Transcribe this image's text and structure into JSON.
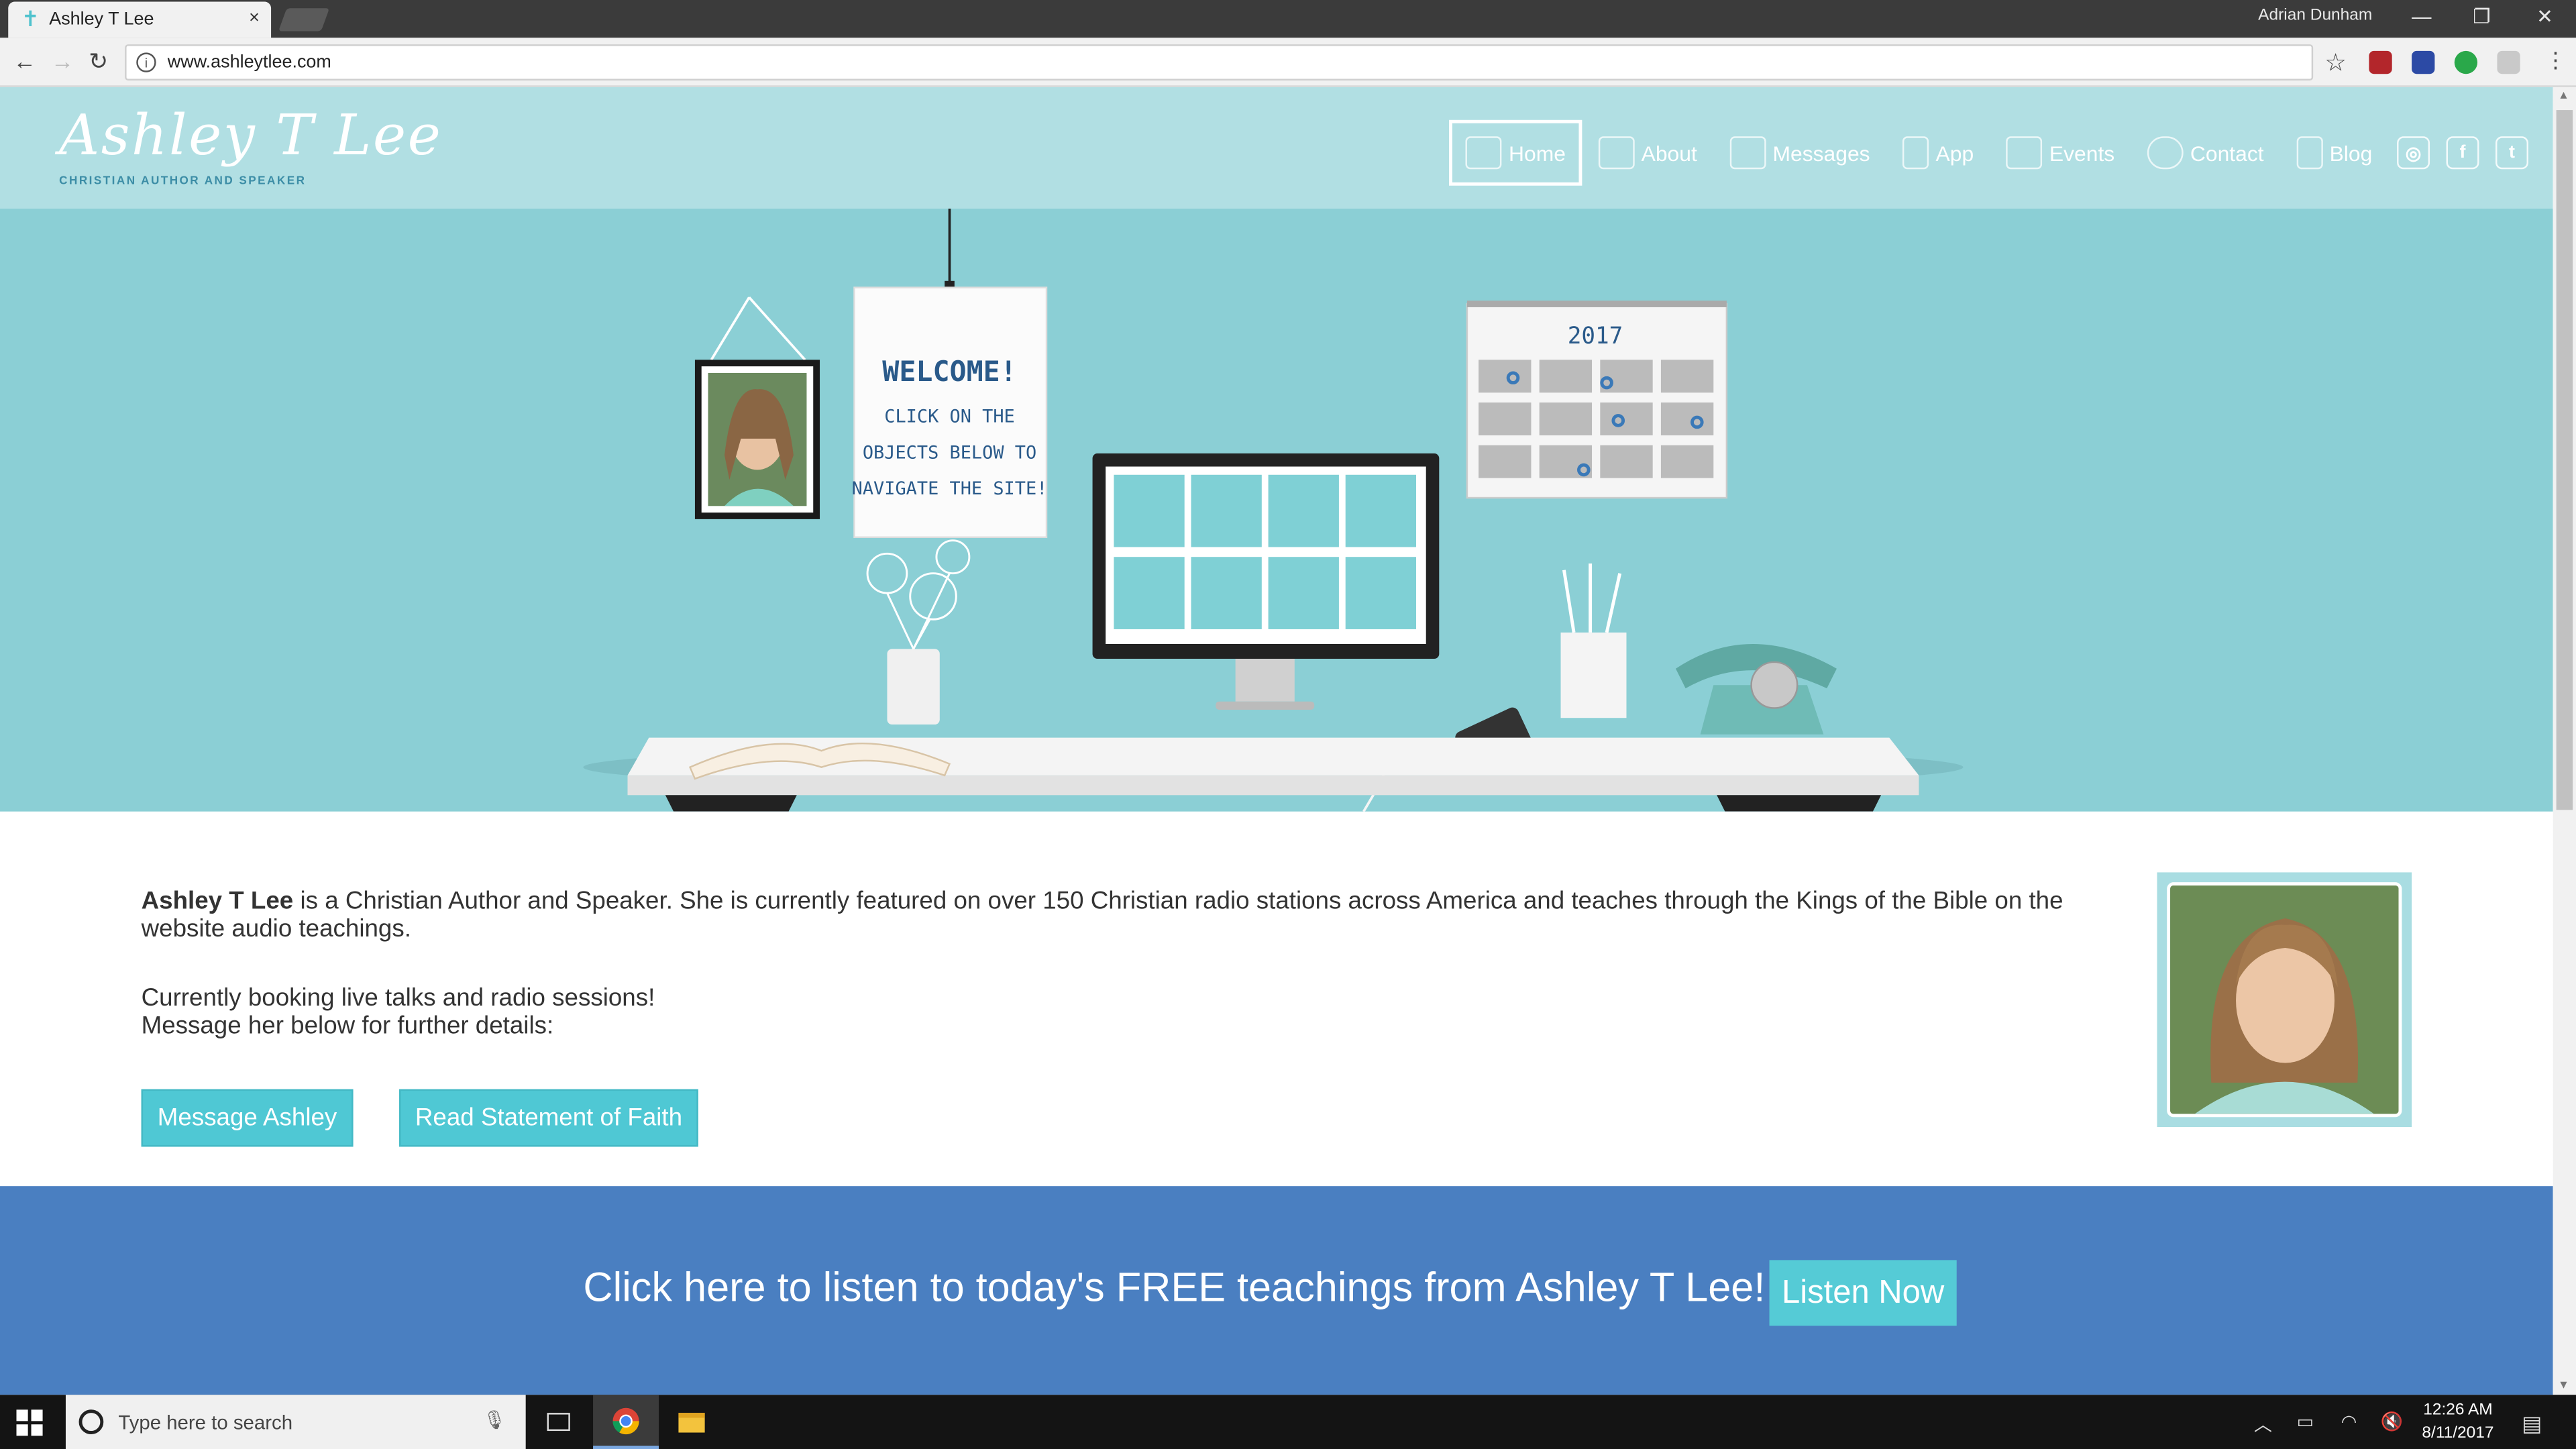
{
  "browser": {
    "tab_title": "Ashley T Lee",
    "tab_close": "×",
    "user_name": "Adrian Dunham",
    "url": "www.ashleytlee.com",
    "window_buttons": [
      "—",
      "❐",
      "✕"
    ]
  },
  "site": {
    "logo_script": "Ashley T Lee",
    "logo_tagline": "CHRISTIAN AUTHOR AND SPEAKER",
    "nav": [
      {
        "label": "Home",
        "active": true
      },
      {
        "label": "About"
      },
      {
        "label": "Messages"
      },
      {
        "label": "App"
      },
      {
        "label": "Events"
      },
      {
        "label": "Contact"
      },
      {
        "label": "Blog"
      }
    ],
    "hero": {
      "welcome_title": "WELCOME!",
      "welcome_lines": [
        "CLICK ON THE",
        "OBJECTS BELOW TO",
        "NAVIGATE THE SITE!"
      ],
      "calendar_year": "2017"
    },
    "intro": {
      "name": "Ashley T Lee",
      "para1_rest": " is a Christian Author and Speaker. She is currently featured on over 150 Christian radio stations across America and teaches through the Kings of the Bible on the website audio teachings.",
      "para2_line1": "Currently booking live talks and radio sessions!",
      "para2_line2": "Message her below for further details:",
      "btn_message": "Message Ashley",
      "btn_faith": "Read Statement of Faith"
    },
    "banner": {
      "text": "Click here to listen to today's FREE teachings from Ashley T Lee!",
      "button": "Listen Now"
    }
  },
  "taskbar": {
    "search_placeholder": "Type here to search",
    "time": "12:26 AM",
    "date": "8/11/2017"
  },
  "colors": {
    "header_bg": "#b1dfe3",
    "hero_bg": "#8bcfd5",
    "button": "#4fc8d4",
    "banner": "#4a7fc1"
  }
}
